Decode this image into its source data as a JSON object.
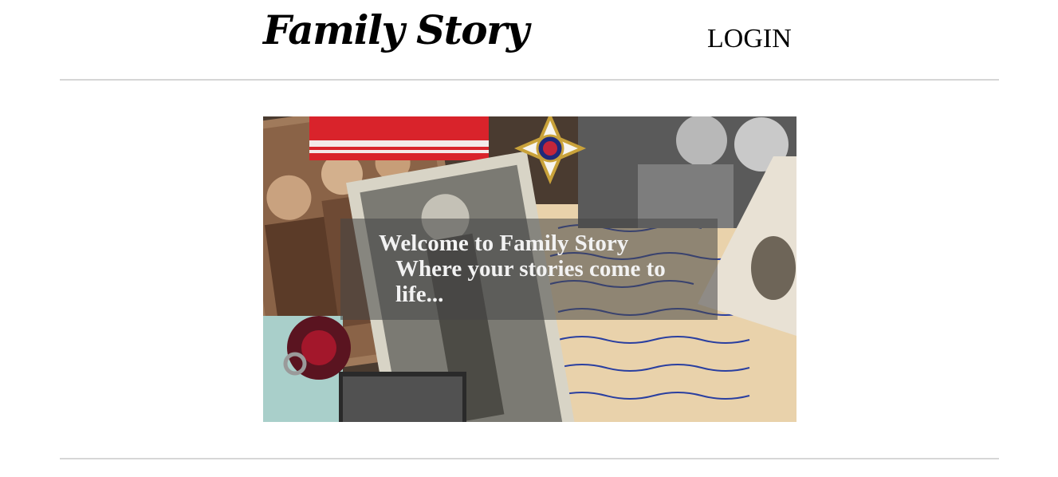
{
  "header": {
    "logo": "Family Story",
    "login": "LOGIN"
  },
  "hero": {
    "image_alt": "Collage of old family photographs, a medal with red ribbon, a garnet ring and handwritten letters",
    "title": "Welcome to Family Story",
    "subtitle": "Where your stories come to life..."
  },
  "colors": {
    "ribbon": "#d9232b",
    "letter_paper": "#e9d2ab",
    "ink": "#2a3fa0",
    "overlay": "#464646"
  }
}
